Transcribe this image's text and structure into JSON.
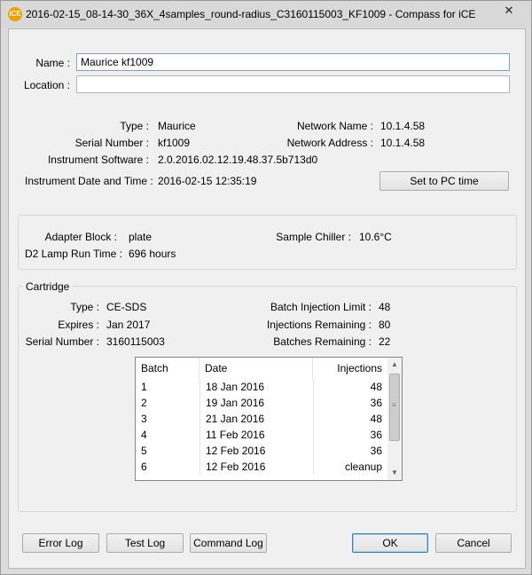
{
  "window": {
    "title": "2016-02-15_08-14-30_36X_4samples_round-radius_C3160115003_KF1009 - Compass for iCE",
    "icon_text": "iCE",
    "close_glyph": "✕"
  },
  "form": {
    "name_label": "Name :",
    "name_value": "Maurice kf1009",
    "location_label": "Location :",
    "location_value": ""
  },
  "instrument": {
    "type_label": "Type :",
    "type_value": "Maurice",
    "serial_label": "Serial Number :",
    "serial_value": "kf1009",
    "software_label": "Instrument Software :",
    "software_value": "2.0.2016.02.12.19.48.37.5b713d0",
    "datetime_label": "Instrument Date and Time :",
    "datetime_value": "2016-02-15 12:35:19",
    "network_name_label": "Network Name :",
    "network_name_value": "10.1.4.58",
    "network_address_label": "Network Address :",
    "network_address_value": "10.1.4.58",
    "set_pc_time_button": "Set to PC time"
  },
  "hardware": {
    "adapter_label": "Adapter Block :",
    "adapter_value": "plate",
    "lamp_label": "D2 Lamp Run Time :",
    "lamp_value": "696 hours",
    "chiller_label": "Sample Chiller :",
    "chiller_value": "10.6°C"
  },
  "cartridge": {
    "group_title": "Cartridge",
    "type_label": "Type :",
    "type_value": "CE-SDS",
    "expires_label": "Expires :",
    "expires_value": "Jan 2017",
    "serial_label": "Serial Number :",
    "serial_value": "3160115003",
    "batch_limit_label": "Batch Injection Limit :",
    "batch_limit_value": "48",
    "inj_remaining_label": "Injections Remaining :",
    "inj_remaining_value": "80",
    "batches_remaining_label": "Batches Remaining :",
    "batches_remaining_value": "22"
  },
  "batch_table": {
    "columns": [
      "Batch",
      "Date",
      "Injections"
    ],
    "rows": [
      {
        "batch": "1",
        "date": "18 Jan 2016",
        "injections": "48"
      },
      {
        "batch": "2",
        "date": "19 Jan 2016",
        "injections": "36"
      },
      {
        "batch": "3",
        "date": "21 Jan 2016",
        "injections": "48"
      },
      {
        "batch": "4",
        "date": "11 Feb 2016",
        "injections": "36"
      },
      {
        "batch": "5",
        "date": "12 Feb 2016",
        "injections": "36"
      },
      {
        "batch": "6",
        "date": "12 Feb 2016",
        "injections": "cleanup"
      }
    ],
    "scroll_up": "▲",
    "scroll_down": "▼"
  },
  "footer": {
    "error_log": "Error Log",
    "test_log": "Test Log",
    "command_log": "Command Log",
    "ok": "OK",
    "cancel": "Cancel"
  },
  "colors": {
    "accent_border": "#3c7fb1",
    "input_focus": "#7da2ce",
    "icon_orange": "#f0a000"
  }
}
